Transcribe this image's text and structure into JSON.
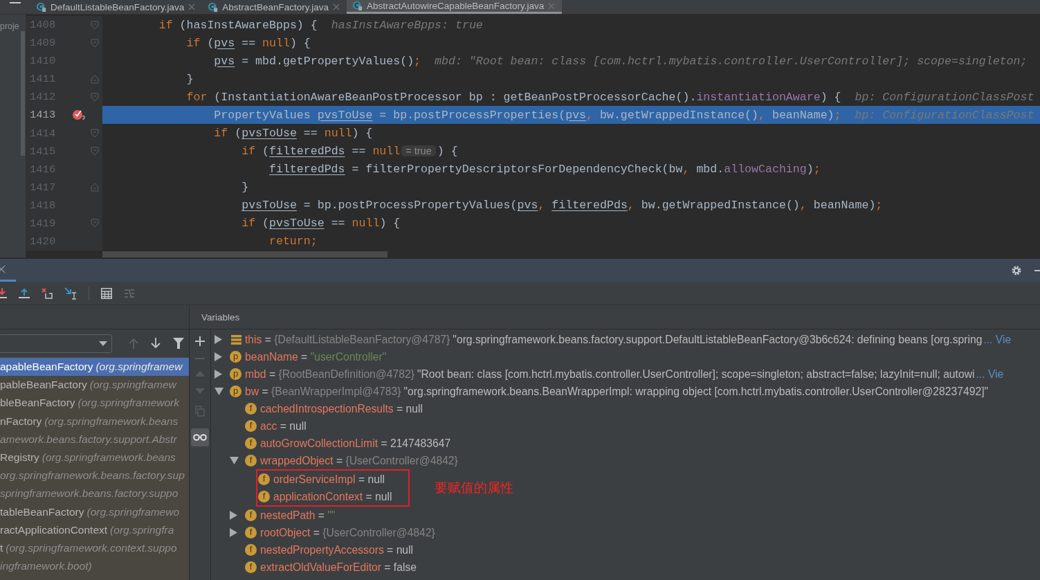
{
  "tabs": [
    {
      "label": "DefaultListableBeanFactory.java",
      "selected": false
    },
    {
      "label": "AbstractBeanFactory.java",
      "selected": false
    },
    {
      "label": "AbstractAutowireCapableBeanFactory.java",
      "selected": true
    }
  ],
  "project_strip": {
    "label": "proje"
  },
  "code_lines": [
    {
      "number": "1408",
      "kind": "block-start",
      "tokens": [
        {
          "kind": "kw",
          "text": "        if"
        },
        {
          "kind": "plain",
          "text": " (hasInstAwareBpps) {"
        }
      ],
      "hint": "hasInstAwareBpps: true"
    },
    {
      "number": "1409",
      "kind": "block-start",
      "tokens": [
        {
          "kind": "kw",
          "text": "            if"
        },
        {
          "kind": "plain",
          "text": " ("
        },
        {
          "kind": "var",
          "text": "pvs"
        },
        {
          "kind": "plain",
          "text": " == "
        },
        {
          "kind": "kw",
          "text": "null"
        },
        {
          "kind": "plain",
          "text": ") {"
        }
      ]
    },
    {
      "number": "1410",
      "kind": "statement",
      "tokens": [
        {
          "kind": "var",
          "text": "                pvs"
        },
        {
          "kind": "plain",
          "text": " = mbd.getPropertyValues()"
        },
        {
          "kind": "punct",
          "text": ";"
        }
      ],
      "hint": "mbd: \"Root bean: class [com.hctrl.mybatis.controller.UserController]; scope=singleton;"
    },
    {
      "number": "1411",
      "kind": "block-end",
      "tokens": [
        {
          "kind": "plain",
          "text": "            }"
        }
      ]
    },
    {
      "number": "1412",
      "kind": "block-start",
      "tokens": [
        {
          "kind": "kw",
          "text": "            for"
        },
        {
          "kind": "plain",
          "text": " (InstantiationAwareBeanPostProcessor bp : getBeanPostProcessorCache()."
        },
        {
          "kind": "field",
          "text": "instantiationAware"
        },
        {
          "kind": "plain",
          "text": ") {"
        }
      ],
      "hint": "bp: ConfigurationClassPost"
    },
    {
      "number": "1413",
      "kind": "statement",
      "current": true,
      "breakpoint": true,
      "tokens": [
        {
          "kind": "plain",
          "text": "                PropertyValues "
        },
        {
          "kind": "var",
          "text": "pvsToUse"
        },
        {
          "kind": "plain",
          "text": " = bp.postProcessProperties("
        },
        {
          "kind": "var",
          "text": "pvs"
        },
        {
          "kind": "punct",
          "text": ", "
        },
        {
          "kind": "plain",
          "text": "bw.getWrappedInstance()"
        },
        {
          "kind": "punct",
          "text": ", "
        },
        {
          "kind": "plain",
          "text": "beanName)"
        },
        {
          "kind": "punct",
          "text": ";"
        }
      ],
      "hint": "bp: ConfigurationClassPost"
    },
    {
      "number": "1414",
      "kind": "block-start",
      "tokens": [
        {
          "kind": "kw",
          "text": "                if"
        },
        {
          "kind": "plain",
          "text": " ("
        },
        {
          "kind": "var",
          "text": "pvsToUse"
        },
        {
          "kind": "plain",
          "text": " == "
        },
        {
          "kind": "kw",
          "text": "null"
        },
        {
          "kind": "plain",
          "text": ") {"
        }
      ]
    },
    {
      "number": "1415",
      "kind": "block-start",
      "tokens": [
        {
          "kind": "kw",
          "text": "                    if"
        },
        {
          "kind": "plain",
          "text": " ("
        },
        {
          "kind": "var",
          "text": "filteredPds"
        },
        {
          "kind": "plain",
          "text": " == "
        },
        {
          "kind": "kw",
          "text": "null"
        },
        {
          "kind": "pill",
          "text": "= true"
        },
        {
          "kind": "plain",
          "text": ") {"
        }
      ]
    },
    {
      "number": "1416",
      "kind": "statement",
      "tokens": [
        {
          "kind": "var",
          "text": "                        filteredPds"
        },
        {
          "kind": "plain",
          "text": " = filterPropertyDescriptorsForDependencyCheck(bw"
        },
        {
          "kind": "punct",
          "text": ", "
        },
        {
          "kind": "plain",
          "text": "mbd."
        },
        {
          "kind": "field",
          "text": "allowCaching"
        },
        {
          "kind": "plain",
          "text": ")"
        },
        {
          "kind": "punct",
          "text": ";"
        }
      ]
    },
    {
      "number": "1417",
      "kind": "block-end",
      "tokens": [
        {
          "kind": "plain",
          "text": "                    }"
        }
      ]
    },
    {
      "number": "1418",
      "kind": "statement",
      "tokens": [
        {
          "kind": "var",
          "text": "                    pvsToUse"
        },
        {
          "kind": "plain",
          "text": " = bp.postProcessPropertyValues("
        },
        {
          "kind": "var",
          "text": "pvs"
        },
        {
          "kind": "punct",
          "text": ", "
        },
        {
          "kind": "var",
          "text": "filteredPds"
        },
        {
          "kind": "punct",
          "text": ", "
        },
        {
          "kind": "plain",
          "text": "bw.getWrappedInstance()"
        },
        {
          "kind": "punct",
          "text": ", "
        },
        {
          "kind": "plain",
          "text": "beanName)"
        },
        {
          "kind": "punct",
          "text": ";"
        }
      ]
    },
    {
      "number": "1419",
      "kind": "block-start",
      "tokens": [
        {
          "kind": "kw",
          "text": "                    if"
        },
        {
          "kind": "plain",
          "text": " ("
        },
        {
          "kind": "var",
          "text": "pvsToUse"
        },
        {
          "kind": "plain",
          "text": " == "
        },
        {
          "kind": "kw",
          "text": "null"
        },
        {
          "kind": "plain",
          "text": ") {"
        }
      ]
    },
    {
      "number": "1420",
      "kind": "statement",
      "tokens": [
        {
          "kind": "kw",
          "text": "                        return"
        },
        {
          "kind": "punct",
          "text": ";"
        }
      ]
    }
  ],
  "debugger": {
    "frames": [
      {
        "method": "apableBeanFactory",
        "location": "(org.springframew",
        "selected": true
      },
      {
        "method": "pableBeanFactory",
        "location": "(org.springframew",
        "selected": false
      },
      {
        "method": "bleBeanFactory",
        "location": "(org.springframework",
        "selected": false
      },
      {
        "method": "nFactory",
        "location": "(org.springframework.beans",
        "selected": false
      },
      {
        "location": "amework.beans.factory.support.Abstr",
        "selected": false
      },
      {
        "method": "Registry",
        "location": "(org.springframework.beans",
        "selected": false
      },
      {
        "location": "org.springframework.beans.factory.sup",
        "selected": false
      },
      {
        "location": "springframework.beans.factory.suppo",
        "selected": false
      },
      {
        "method": "tableBeanFactory",
        "location": "(org.springframewo",
        "selected": false
      },
      {
        "method": "ractApplicationContext",
        "location": "(org.springfra",
        "selected": false
      },
      {
        "method": "t",
        "location": "(org.springframework.context.suppo",
        "selected": false
      },
      {
        "location": "ingframework.boot)",
        "selected": false
      }
    ],
    "variables_title": "Variables",
    "variables": [
      {
        "name": "this",
        "op": "=",
        "value_type": "{DefaultListableBeanFactory@4787}",
        "value": "\"org.springframework.beans.factory.support.DefaultListableBeanFactory@3b6c624: defining beans [org.spring",
        "link": "... Vie",
        "expanded": false
      },
      {
        "name": "beanName",
        "badge": "p",
        "op": "=",
        "string": "\"userController\"",
        "expanded": false
      },
      {
        "name": "mbd",
        "badge": "p",
        "op": "=",
        "value_type": "{RootBeanDefinition@4782}",
        "value": "\"Root bean: class [com.hctrl.mybatis.controller.UserController]; scope=singleton; abstract=false; lazyInit=null; autowi",
        "link": "... Vie",
        "expanded": false
      },
      {
        "name": "bw",
        "badge": "p",
        "op": "=",
        "value_type": "{BeanWrapperImpl@4783}",
        "value": "\"org.springframework.beans.BeanWrapperImpl: wrapping object [com.hctrl.mybatis.controller.UserController@28237492]\"",
        "expanded": true,
        "children": [
          {
            "name": "cachedIntrospectionResults",
            "badge": "f",
            "op": "=",
            "value": "null"
          },
          {
            "name": "acc",
            "badge": "f",
            "op": "=",
            "value": "null"
          },
          {
            "name": "autoGrowCollectionLimit",
            "badge": "f",
            "op": "=",
            "value": "2147483647"
          },
          {
            "name": "wrappedObject",
            "badge": "f",
            "op": "=",
            "value_type": "{UserController@4842}",
            "expanded": true,
            "annotation": "要赋值的属性",
            "children": [
              {
                "name": "orderServiceImpl",
                "badge": "f",
                "op": "=",
                "value": "null"
              },
              {
                "name": "applicationContext",
                "badge": "f",
                "op": "=",
                "value": "null"
              }
            ]
          },
          {
            "name": "nestedPath",
            "badge": "f",
            "op": "=",
            "string": "\"\"",
            "expanded": false
          },
          {
            "name": "rootObject",
            "badge": "f",
            "op": "=",
            "value_type": "{UserController@4842}",
            "expanded": false
          },
          {
            "name": "nestedPropertyAccessors",
            "badge": "f",
            "op": "=",
            "value": "null"
          },
          {
            "name": "extractOldValueForEditor",
            "badge": "f",
            "op": "=",
            "value": "false"
          }
        ]
      }
    ]
  }
}
